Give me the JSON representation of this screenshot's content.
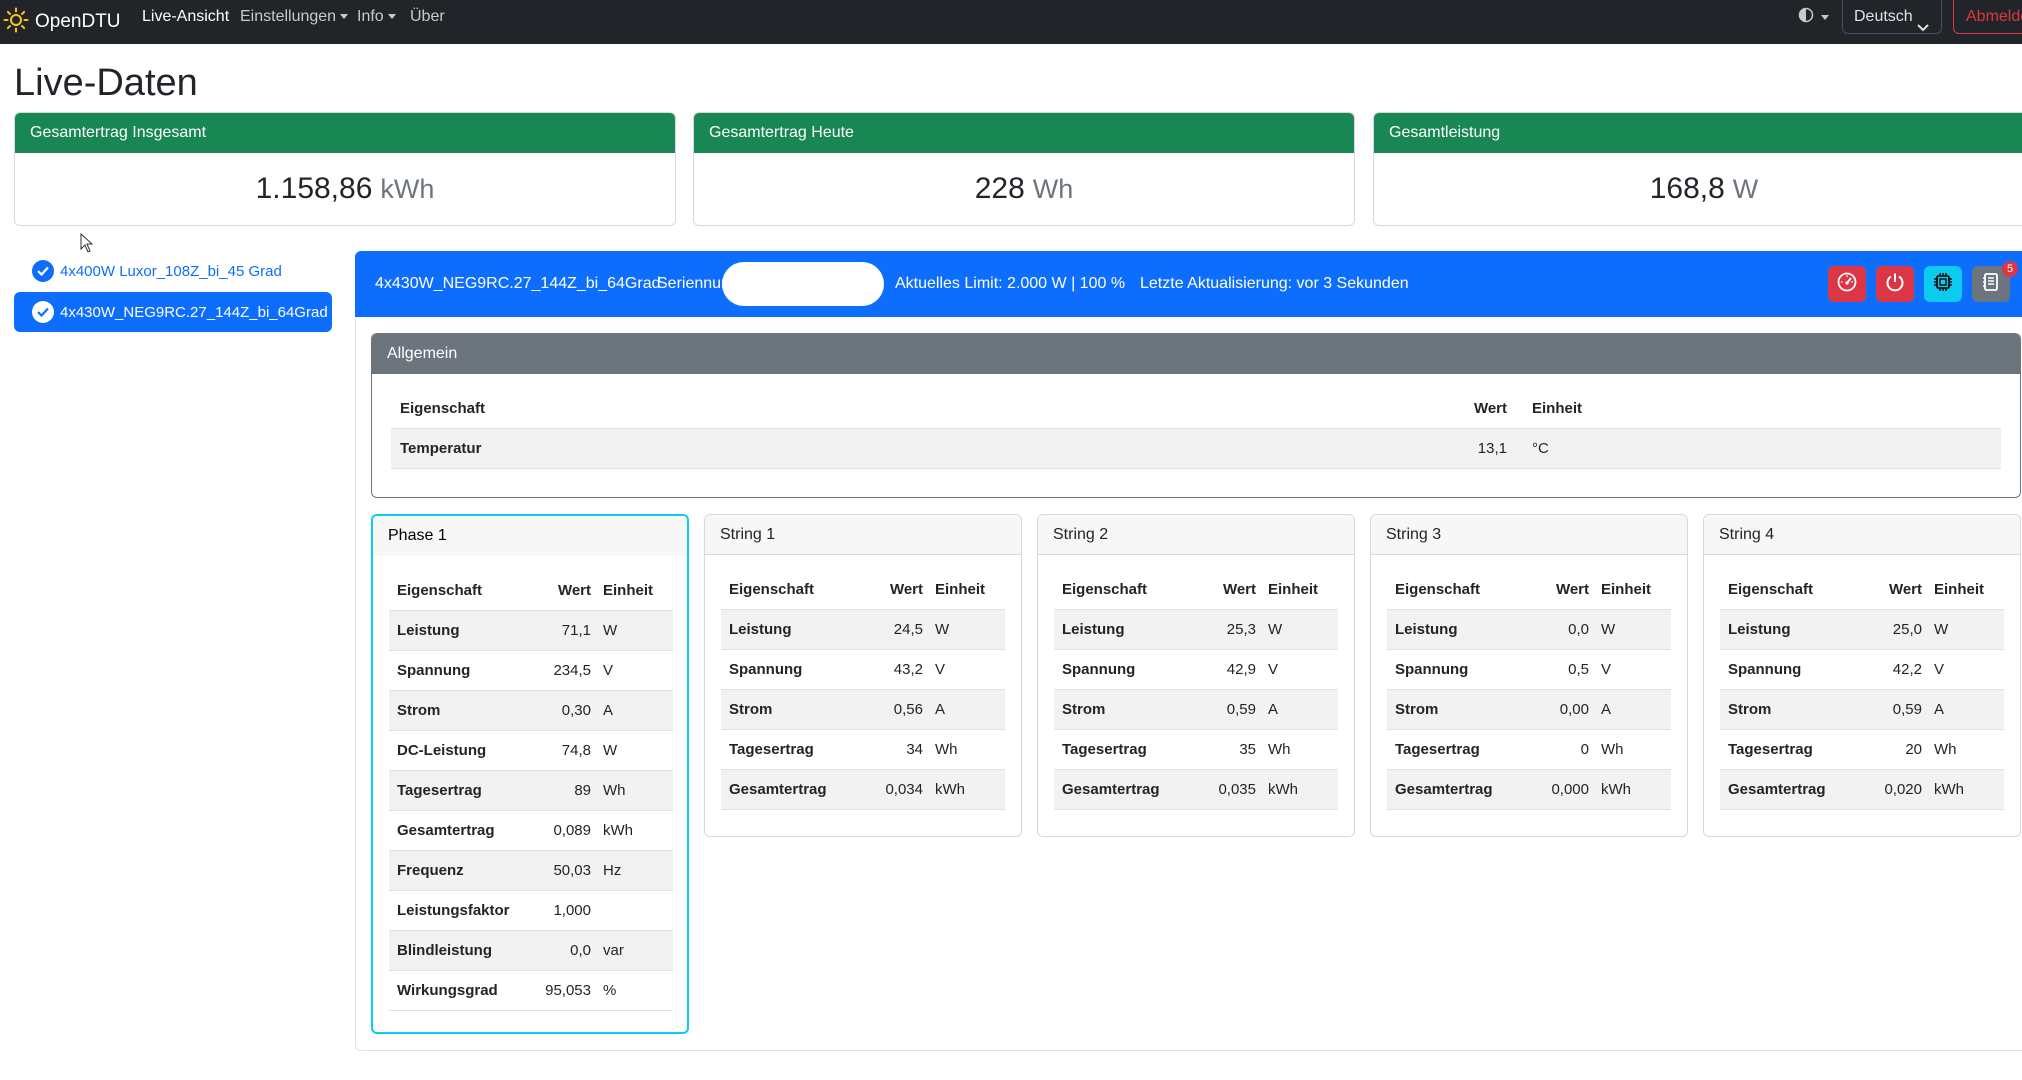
{
  "navbar": {
    "brand": "OpenDTU",
    "items": [
      {
        "label": "Live-Ansicht",
        "active": true,
        "dropdown": false
      },
      {
        "label": "Einstellungen",
        "active": false,
        "dropdown": true
      },
      {
        "label": "Info",
        "active": false,
        "dropdown": true
      },
      {
        "label": "Über",
        "active": false,
        "dropdown": false
      }
    ],
    "language": "Deutsch",
    "logout": "Abmelden"
  },
  "page_title": "Live-Daten",
  "summary": [
    {
      "title": "Gesamtertrag Insgesamt",
      "value": "1.158,86",
      "unit": "kWh"
    },
    {
      "title": "Gesamtertrag Heute",
      "value": "228",
      "unit": "Wh"
    },
    {
      "title": "Gesamtleistung",
      "value": "168,8",
      "unit": "W"
    }
  ],
  "inverters": [
    {
      "name": "4x400W Luxor_108Z_bi_45 Grad",
      "active": false
    },
    {
      "name": "4x430W_NEG9RC.27_144Z_bi_64Grad",
      "active": true
    }
  ],
  "inverter_header": {
    "name": "4x430W_NEG9RC.27_144Z_bi_64Grad",
    "serial_label": "Seriennummer",
    "limit": "Aktuelles Limit: 2.000 W | 100 %",
    "last_update": "Letzte Aktualisierung: vor 3 Sekunden",
    "notification_count": "5"
  },
  "colors": {
    "success": "#198754",
    "primary": "#0d6efd",
    "danger": "#dc3545",
    "info": "#0dcaf0",
    "secondary": "#6c757d"
  },
  "general": {
    "title": "Allgemein",
    "headers": [
      "Eigenschaft",
      "Wert",
      "Einheit"
    ],
    "rows": [
      {
        "prop": "Temperatur",
        "value": "13,1",
        "unit": "°C"
      }
    ]
  },
  "channels": [
    {
      "title": "Phase 1",
      "headers": [
        "Eigenschaft",
        "Wert",
        "Einheit"
      ],
      "rows": [
        {
          "prop": "Leistung",
          "value": "71,1",
          "unit": "W"
        },
        {
          "prop": "Spannung",
          "value": "234,5",
          "unit": "V"
        },
        {
          "prop": "Strom",
          "value": "0,30",
          "unit": "A"
        },
        {
          "prop": "DC-Leistung",
          "value": "74,8",
          "unit": "W"
        },
        {
          "prop": "Tagesertrag",
          "value": "89",
          "unit": "Wh"
        },
        {
          "prop": "Gesamtertrag",
          "value": "0,089",
          "unit": "kWh"
        },
        {
          "prop": "Frequenz",
          "value": "50,03",
          "unit": "Hz"
        },
        {
          "prop": "Leistungsfaktor",
          "value": "1,000",
          "unit": ""
        },
        {
          "prop": "Blindleistung",
          "value": "0,0",
          "unit": "var"
        },
        {
          "prop": "Wirkungsgrad",
          "value": "95,053",
          "unit": "%"
        }
      ]
    },
    {
      "title": "String 1",
      "headers": [
        "Eigenschaft",
        "Wert",
        "Einheit"
      ],
      "rows": [
        {
          "prop": "Leistung",
          "value": "24,5",
          "unit": "W"
        },
        {
          "prop": "Spannung",
          "value": "43,2",
          "unit": "V"
        },
        {
          "prop": "Strom",
          "value": "0,56",
          "unit": "A"
        },
        {
          "prop": "Tagesertrag",
          "value": "34",
          "unit": "Wh"
        },
        {
          "prop": "Gesamtertrag",
          "value": "0,034",
          "unit": "kWh"
        }
      ]
    },
    {
      "title": "String 2",
      "headers": [
        "Eigenschaft",
        "Wert",
        "Einheit"
      ],
      "rows": [
        {
          "prop": "Leistung",
          "value": "25,3",
          "unit": "W"
        },
        {
          "prop": "Spannung",
          "value": "42,9",
          "unit": "V"
        },
        {
          "prop": "Strom",
          "value": "0,59",
          "unit": "A"
        },
        {
          "prop": "Tagesertrag",
          "value": "35",
          "unit": "Wh"
        },
        {
          "prop": "Gesamtertrag",
          "value": "0,035",
          "unit": "kWh"
        }
      ]
    },
    {
      "title": "String 3",
      "headers": [
        "Eigenschaft",
        "Wert",
        "Einheit"
      ],
      "rows": [
        {
          "prop": "Leistung",
          "value": "0,0",
          "unit": "W"
        },
        {
          "prop": "Spannung",
          "value": "0,5",
          "unit": "V"
        },
        {
          "prop": "Strom",
          "value": "0,00",
          "unit": "A"
        },
        {
          "prop": "Tagesertrag",
          "value": "0",
          "unit": "Wh"
        },
        {
          "prop": "Gesamtertrag",
          "value": "0,000",
          "unit": "kWh"
        }
      ]
    },
    {
      "title": "String 4",
      "headers": [
        "Eigenschaft",
        "Wert",
        "Einheit"
      ],
      "rows": [
        {
          "prop": "Leistung",
          "value": "25,0",
          "unit": "W"
        },
        {
          "prop": "Spannung",
          "value": "42,2",
          "unit": "V"
        },
        {
          "prop": "Strom",
          "value": "0,59",
          "unit": "A"
        },
        {
          "prop": "Tagesertrag",
          "value": "20",
          "unit": "Wh"
        },
        {
          "prop": "Gesamtertrag",
          "value": "0,020",
          "unit": "kWh"
        }
      ]
    }
  ]
}
